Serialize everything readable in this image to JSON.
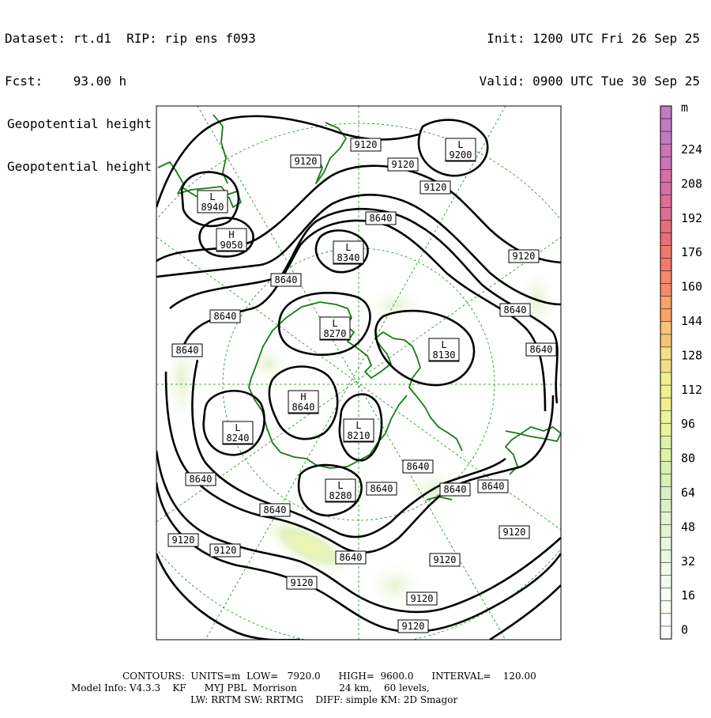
{
  "header": {
    "dataset_line": "Dataset: rt.d1  RIP: rip ens f093",
    "fcst_line": "Fcst:    93.00 h",
    "field_line_1": "Geopotential height",
    "field_line_2": "Geopotential height",
    "init_line": "Init: 1200 UTC Fri 26 Sep 25",
    "valid_line": "Valid: 0900 UTC Tue 30 Sep 25"
  },
  "colors": {
    "contour": "#000000",
    "coast": "#1a7a1a",
    "grid": "#1a8a1a",
    "shade_light": "#eef7e3",
    "shade_mid": "#dff0c8",
    "shade_strong": "#f0f5a8"
  },
  "map": {
    "contour_labels": [
      "9120",
      "9120",
      "9120",
      "9120",
      "9200",
      "8940",
      "9050",
      "8640",
      "8340",
      "8640",
      "9120",
      "8640",
      "8640",
      "8640",
      "8270",
      "8130",
      "8640",
      "8640",
      "8240",
      "8210",
      "8640",
      "8640",
      "8640",
      "8640",
      "8280",
      "8640",
      "8640",
      "9120",
      "9120",
      "9120",
      "8640",
      "9120",
      "9120",
      "9120",
      "9120"
    ],
    "highs_lows": [
      {
        "kind": "L",
        "value": "9200"
      },
      {
        "kind": "L",
        "value": "8940"
      },
      {
        "kind": "H",
        "value": "9050"
      },
      {
        "kind": "L",
        "value": "8340"
      },
      {
        "kind": "L",
        "value": "8270"
      },
      {
        "kind": "L",
        "value": "8130"
      },
      {
        "kind": "H",
        "value": "8640"
      },
      {
        "kind": "L",
        "value": "8240"
      },
      {
        "kind": "L",
        "value": "8210"
      },
      {
        "kind": "L",
        "value": "8280"
      }
    ]
  },
  "colorbar": {
    "unit": "m",
    "tick_labels": [
      "224",
      "208",
      "192",
      "176",
      "160",
      "144",
      "128",
      "112",
      "96",
      "80",
      "64",
      "48",
      "32",
      "16",
      "0"
    ],
    "colors": [
      "#c27ac2",
      "#cc74b6",
      "#d66fa6",
      "#dd6e95",
      "#e66f7c",
      "#ef7a6c",
      "#f58a66",
      "#f8a468",
      "#f6c476",
      "#f3df88",
      "#f2f08e",
      "#eaf59a",
      "#dff2a8",
      "#d7efb2",
      "#daf0c6",
      "#e2f4d3",
      "#eaf7e0",
      "#f1faeb",
      "#f8fdf4",
      "#ffffff"
    ]
  },
  "footer": {
    "contours_line": "CONTOURS:  UNITS=m  LOW=   7920.0      HIGH=  9600.0      INTERVAL=    120.00",
    "model_line": "Model Info: V4.3.3    KF      MYJ PBL  Morrison              24 km,    60 levels,",
    "physics_line": "LW: RRTM SW: RRTMG    DIFF: simple KM: 2D Smagor"
  }
}
